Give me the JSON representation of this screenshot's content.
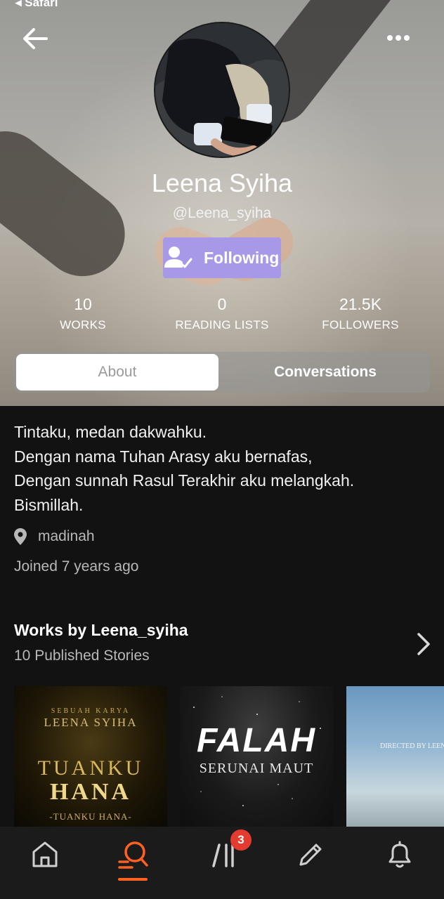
{
  "status_bar": {
    "back_app": "◂ Safari"
  },
  "profile": {
    "name": "Leena Syiha",
    "handle": "@Leena_syiha",
    "follow_label": "Following",
    "stats": [
      {
        "value": "10",
        "label": "WORKS"
      },
      {
        "value": "0",
        "label": "READING LISTS"
      },
      {
        "value": "21.5K",
        "label": "FOLLOWERS"
      }
    ]
  },
  "tabs": {
    "about": "About",
    "conversations": "Conversations",
    "active": "About"
  },
  "about": {
    "bio_lines": [
      "Tintaku, medan dakwahku.",
      "Dengan nama Tuhan Arasy aku bernafas,",
      "Dengan sunnah Rasul Terakhir aku melangkah.",
      "Bismillah."
    ],
    "location": "madinah",
    "joined": "Joined 7 years ago"
  },
  "works": {
    "title": "Works by Leena_syiha",
    "subtitle": "10 Published Stories",
    "covers": [
      {
        "small_text": "SEBUAH KARYA",
        "author": "LEENA SYIHA",
        "title_line1": "TUANKU",
        "title_line2": "HANA",
        "footer": "-TUANKU HANA-"
      },
      {
        "title": "FALAH",
        "subtitle": "SERUNAI MAUT"
      },
      {
        "text": "DIRECTED BY LEENA"
      }
    ]
  },
  "bottom_nav": {
    "items": [
      "home-icon",
      "search-icon",
      "library-icon",
      "write-icon",
      "notifications-icon"
    ],
    "active": "search-icon",
    "library_badge": "3"
  },
  "colors": {
    "accent": "#ff6122",
    "follow_button": "#a799e8",
    "badge": "#e33b2f",
    "background": "#121212"
  }
}
